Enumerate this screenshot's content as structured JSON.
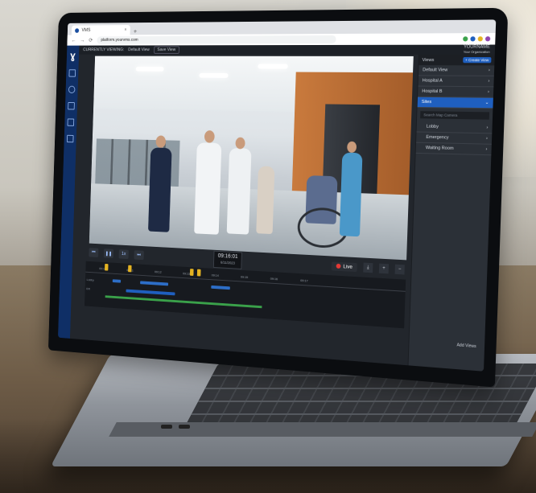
{
  "browser": {
    "tab_title": "VMS",
    "tab_close": "×",
    "new_tab": "+",
    "url": "platform.yourvms.com"
  },
  "topbar": {
    "currently_viewing_label": "CURRENTLY VIEWING:",
    "current_view": "Default View",
    "save_label": "Save View"
  },
  "user": {
    "name": "YOURNAME",
    "org": "Your Organization"
  },
  "views_panel": {
    "title": "Views",
    "add_button": "+ Create View",
    "views": [
      {
        "label": "Default View",
        "active": false
      },
      {
        "label": "Hospital A",
        "active": false
      },
      {
        "label": "Hospital B",
        "active": false
      },
      {
        "label": "Sites",
        "active": true
      }
    ],
    "search_placeholder": "Search Map Camera",
    "sub_items": [
      "Lobby",
      "Emergency",
      "Waiting Room"
    ],
    "footer": "Add Views"
  },
  "playback": {
    "time": "09:16:01",
    "date": "6/11/2023",
    "live_label": "Live"
  },
  "timeline": {
    "labels": [
      "09:10",
      "09:11",
      "09:12",
      "09:13",
      "09:14",
      "09:15",
      "09:16",
      "09:17"
    ],
    "track_label_1": "Lobby",
    "track_label_2": "ER"
  },
  "colors": {
    "accent": "#1f5fbf",
    "live_dot": "#e53935",
    "marker": "#e4b322",
    "rail": "#0f2f66"
  }
}
